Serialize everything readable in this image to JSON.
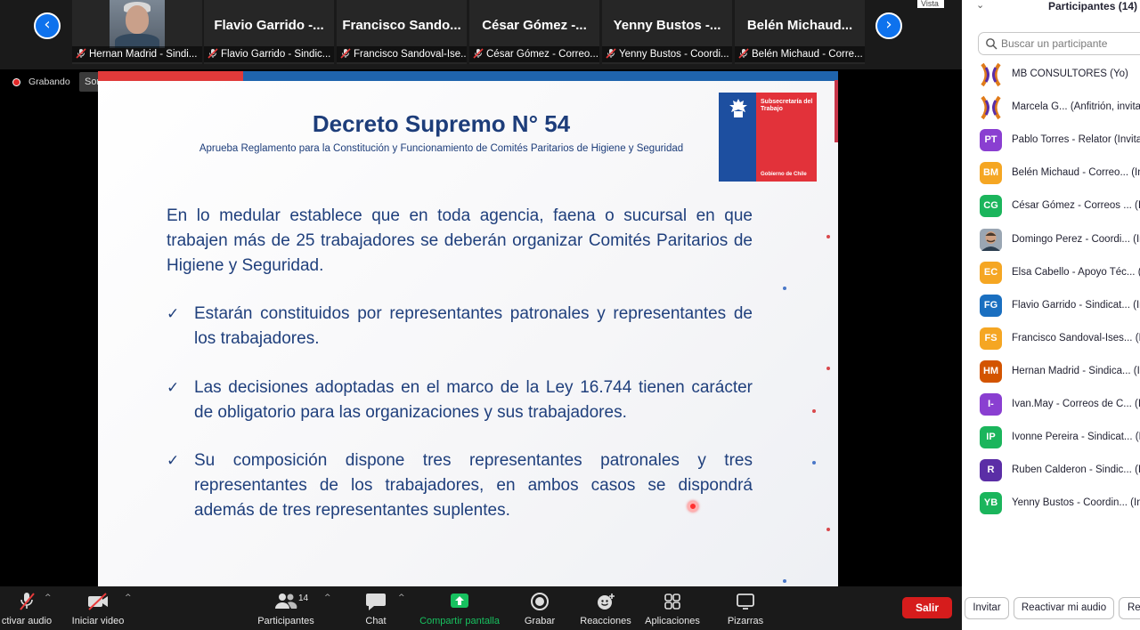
{
  "gallery": {
    "tiles": [
      {
        "name": "",
        "label": "Hernan Madrid - Sindi..."
      },
      {
        "name": "Flavio Garrido -...",
        "label": "Flavio Garrido - Sindic..."
      },
      {
        "name": "Francisco Sando...",
        "label": "Francisco Sandoval-Ise..."
      },
      {
        "name": "César Gómez -...",
        "label": "César Gómez - Correo..."
      },
      {
        "name": "Yenny Bustos -...",
        "label": "Yenny Bustos - Coordi..."
      },
      {
        "name": "Belén Michaud...",
        "label": "Belén Michaud - Corre..."
      }
    ],
    "prev_icon": "‹",
    "next_icon": "›"
  },
  "recording": {
    "label": "Grabando",
    "original_sound": "Sonido original: activado",
    "caret": "▾"
  },
  "slide": {
    "title": "Decreto Supremo N° 54",
    "subtitle": "Aprueba Reglamento para la Constitución y Funcionamiento de Comités Paritarios de Higiene y Seguridad",
    "logo_line1": "Subsecretaría del Trabajo",
    "logo_line2": "Gobierno de Chile",
    "body": "En lo medular establece que en toda agencia, faena o sucursal en que trabajen más de 25 trabajadores se deberán organizar Comités Paritarios de Higiene y Seguridad.",
    "check": "✓",
    "bullets": [
      "Estarán constituidos por representantes patronales y representantes de los trabajadores.",
      "Las decisiones adoptadas en el marco de la Ley 16.744 tienen carácter de obligatorio para las organizaciones y sus trabajadores.",
      "Su composición dispone tres representantes patronales y tres representantes de los trabajadores, en ambos casos se dispondrá además de tres representantes suplentes."
    ]
  },
  "toolbar": {
    "audio": "ctivar audio",
    "video": "Iniciar video",
    "participants": "Participantes",
    "participants_count": "14",
    "chat": "Chat",
    "share": "Compartir pantalla",
    "record": "Grabar",
    "reactions": "Reacciones",
    "apps": "Aplicaciones",
    "whiteboards": "Pizarras",
    "leave": "Salir",
    "caret": "^"
  },
  "panel": {
    "vista": "Vista",
    "title": "Participantes (14)",
    "chevron": "⌄",
    "search_placeholder": "Buscar un participante",
    "participants": [
      {
        "initials": "",
        "name": "MB CONSULTORES (Yo)",
        "color": "#ffffff"
      },
      {
        "initials": "",
        "name": "Marcela G... (Anfitrión, invitad",
        "color": "#ffffff"
      },
      {
        "initials": "PT",
        "name": "Pablo Torres - Relator (Invitad",
        "color": "#8a3fd1"
      },
      {
        "initials": "BM",
        "name": "Belén Michaud - Correo... (In",
        "color": "#f5a623"
      },
      {
        "initials": "CG",
        "name": "César Gómez - Correos ... (In",
        "color": "#1bb55c"
      },
      {
        "initials": "",
        "name": "Domingo Perez - Coordi... (In",
        "color": "#ffffff"
      },
      {
        "initials": "EC",
        "name": "Elsa Cabello - Apoyo Téc... (In",
        "color": "#f5a623"
      },
      {
        "initials": "FG",
        "name": "Flavio Garrido - Sindicat... (In",
        "color": "#1a6fc0"
      },
      {
        "initials": "FS",
        "name": "Francisco Sandoval-Ises... (In",
        "color": "#f5a623"
      },
      {
        "initials": "HM",
        "name": "Hernan Madrid - Sindica... (In",
        "color": "#d35400"
      },
      {
        "initials": "I-",
        "name": "Ivan.May - Correos de C... (In",
        "color": "#8a3fd1"
      },
      {
        "initials": "IP",
        "name": "Ivonne Pereira - Sindicat... (In",
        "color": "#1bb55c"
      },
      {
        "initials": "R",
        "name": "Ruben Calderon - Sindic... (In",
        "color": "#5b2ea6"
      },
      {
        "initials": "YB",
        "name": "Yenny Bustos - Coordin... (In",
        "color": "#1bb55c"
      }
    ],
    "invite": "Invitar",
    "unmute_me": "Reactivar mi audio",
    "more": "Re"
  }
}
